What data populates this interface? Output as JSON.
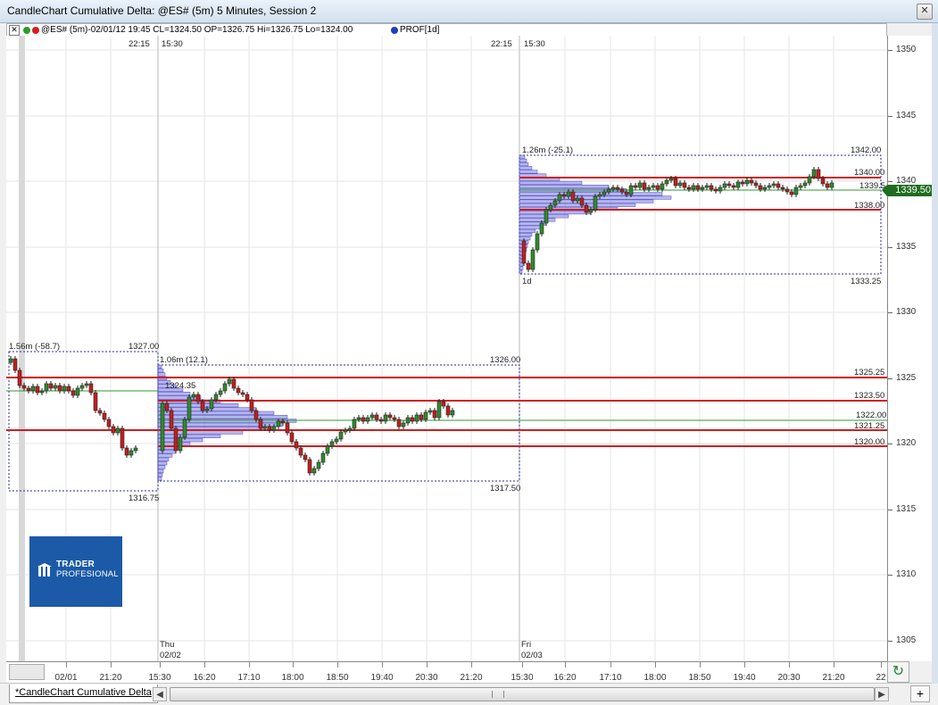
{
  "window": {
    "title": "CandleChart Cumulative Delta: @ES# (5m) 5 Minutes, Session 2",
    "close_glyph": "✕"
  },
  "infobar": {
    "close_glyph": "✕",
    "symbol_text": "@ES# (5m)-02/01/12 19:45 CL=1324.50 OP=1326.75 Hi=1326.75 Lo=1324.00",
    "indicator_text": "PROF[1d]",
    "dot_colors": [
      "#2e9b2e",
      "#d11d1d",
      "#1f3fbf"
    ]
  },
  "chart": {
    "session_labels": [
      "22:15",
      "15:30",
      "22:15",
      "15:30"
    ],
    "day_labels": [
      {
        "day": "Thu",
        "date": "02/02"
      },
      {
        "day": "Fri",
        "date": "02/03"
      }
    ],
    "profiles": [
      {
        "label": "1.56m (-58.7)",
        "high": "1327.00",
        "low": "1316.75"
      },
      {
        "label": "1.06m (12.1)",
        "high": "1326.00",
        "low": "1317.50",
        "poc": "1324.35"
      },
      {
        "label": "1.26m (-25.1)",
        "high": "1342.00",
        "low": "1333.25",
        "period": "1d"
      }
    ],
    "levels": [
      "1325.25",
      "1323.50",
      "1322.00",
      "1321.25",
      "1320.00",
      "1340.00",
      "1339.5",
      "1338.00"
    ],
    "colors": {
      "up": "#2e8b2e",
      "down": "#c41e1e",
      "profile": "#5a5ad2",
      "level_red": "#d11d1d",
      "level_green": "#2e9b2e"
    }
  },
  "price_axis": {
    "ticks": [
      "1350",
      "1345",
      "1340",
      "1335",
      "1330",
      "1325",
      "1320",
      "1315",
      "1310",
      "1305"
    ],
    "last_price": "1339.50"
  },
  "time_axis": {
    "labels": [
      "02/01",
      "21:20",
      "15:30",
      "16:20",
      "17:10",
      "18:00",
      "18:50",
      "19:40",
      "20:30",
      "21:20",
      "15:30",
      "16:20",
      "17:10",
      "18:00",
      "18:50",
      "19:40",
      "20:30",
      "21:20",
      "22"
    ]
  },
  "logo": {
    "line1": "TRADER",
    "line2": "PROFESIONAL"
  },
  "tabs": {
    "active": "*CandleChart Cumulative Delta"
  },
  "scrollbar": {
    "left_glyph": "◀",
    "right_glyph": "▶",
    "plus": "+",
    "refresh_glyph": "↻"
  }
}
